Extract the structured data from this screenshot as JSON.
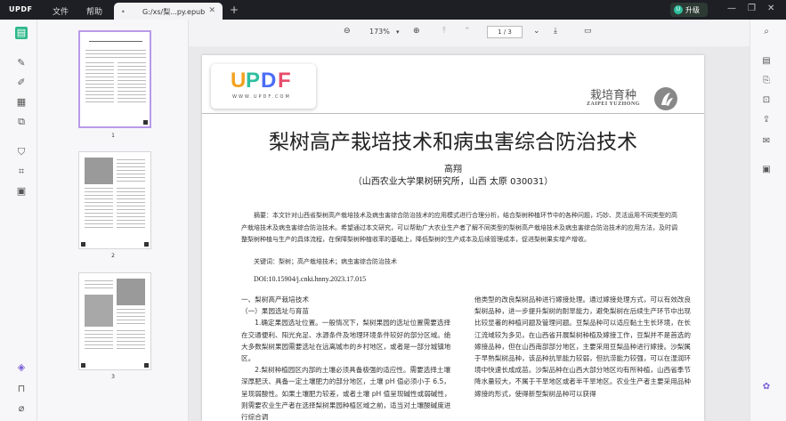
{
  "titlebar": {
    "logo": "UPDF",
    "menu_file": "文件",
    "menu_help": "帮助",
    "tab_name": "G:/xs/梨...py.epub",
    "upgrade_label": "升级",
    "upgrade_badge": "U"
  },
  "toolbar": {
    "zoom": "173%",
    "page_current": "1",
    "page_sep": "/",
    "page_total": "3"
  },
  "thumbnails": [
    {
      "label": "1"
    },
    {
      "label": "2"
    },
    {
      "label": "3"
    }
  ],
  "document": {
    "logo_text": "UPDF",
    "logo_url": "WWW.UPDF.COM",
    "brand_cn": "栽培育种",
    "brand_en": "ZAIPEI   YUZHONG",
    "title": "梨树高产栽培技术和病虫害综合防治技术",
    "author": "高翔",
    "affiliation": "（山西农业大学果树研究所，山西  太原  030031）",
    "abstract": "摘要：本文针对山西省梨树高产栽培技术及病虫害综合防治技术的应用模式进行合理分析，结合梨树种植环节中的各种问题，巧妙、灵活运用不同类型的高产栽培技术及病虫害综合防治技术。希望通过本文研究，可以帮助广大农业生产者了解不同类型的梨树高产栽培技术及病虫害综合防治技术的应用方法，及时调整梨树种植与生产的具体流程，在保障梨树种植收率的基础上，降低梨树的生产成本及后续管理成本，促进梨树果实增产增收。",
    "keywords": "关键词：梨树；高产栽培技术；病虫害综合防治技术",
    "doi": "DOI:10.15904/j.cnki.hnny.2023.17.015",
    "left_col": [
      "一、梨树高产栽培技术",
      "（一）果园选址与育苗",
      "　　1.确定果园选址位置。一般情况下，梨树果园的选址位置需要选择在交通便利、阳光充足、水源条件及地理环境条件较好的部分区域。绝大多数梨树果园需要选址在远离城市的乡村地区，或者是一部分城镇地区。",
      "　　2.梨树种植园区内部的土壤必须具备极强的适应性。需要选择土壤深厚肥沃、具备一定土壤肥力的部分地区，土壤 pH 值必须小于 6.5，呈现弱酸性。如果土壤肥力较差，或者土壤 pH 值呈现碱性或弱碱性，则需要农业生产者在选择梨树果园种植区域之前，适当对土壤酸碱度进行综合调"
    ],
    "right_col": [
      "他类型的改良梨树品种进行嫁接处理。通过嫁接处理方式，可以有效改良梨树品种，进一步提升梨树的耐旱能力，避免梨树在后续生产环节中出现比较显著的种植问题及管理问题。豆梨品种可以适应黏土生长环境，在长江流域较为多见，在山西省开展梨树种植及嫁接工作，豆梨并不是首选的嫁接品种，但在山西南部部分地区，主要采用豆梨品种进行嫁接。沙梨属于早熟梨树品种，该品种抗旱能力较弱，但抗涝能力较强，可以在湿润环境中快速长成成苗。沙梨品种在山西大部分地区均有所种植，山西省季节降水量较大，不属于干旱地区或者半干旱地区。农业生产者主要采用品种嫁接的形式，使得新型梨树品种可以获得"
    ]
  },
  "colors": {
    "accent": "#2db88a",
    "updf_u": "#f2a11f",
    "updf_p": "#2fbf9f",
    "updf_d": "#4a6cf7",
    "updf_f": "#e84d6b"
  }
}
